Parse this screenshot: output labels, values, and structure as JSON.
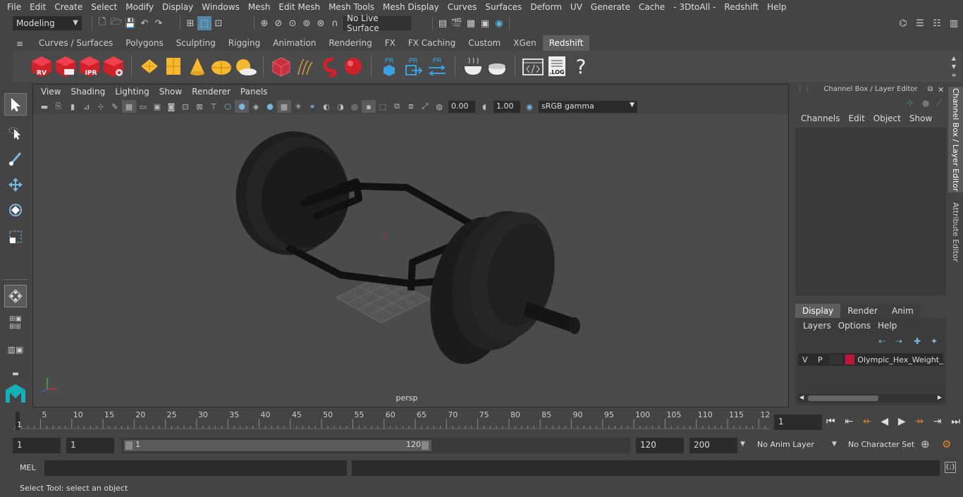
{
  "menubar": [
    "File",
    "Edit",
    "Create",
    "Select",
    "Modify",
    "Display",
    "Windows",
    "Mesh",
    "Edit Mesh",
    "Mesh Tools",
    "Mesh Display",
    "Curves",
    "Surfaces",
    "Deform",
    "UV",
    "Generate",
    "Cache",
    "- 3DtoAll -",
    "Redshift",
    "Help"
  ],
  "workspace": "Modeling",
  "live_surface": "No Live Surface",
  "shelf_tabs": [
    "Curves / Surfaces",
    "Polygons",
    "Sculpting",
    "Rigging",
    "Animation",
    "Rendering",
    "FX",
    "FX Caching",
    "Custom",
    "XGen",
    "Redshift"
  ],
  "shelf_active": "Redshift",
  "shelf_labels": {
    "rv": "RV",
    "ipr": "IPR",
    "pr": "PR",
    "log": ".LOG",
    "help": "?"
  },
  "viewport": {
    "menus": [
      "View",
      "Shading",
      "Lighting",
      "Show",
      "Renderer",
      "Panels"
    ],
    "exposure": "0.00",
    "gamma": "1.00",
    "colorspace": "sRGB gamma",
    "camera_label": "persp"
  },
  "channel_box": {
    "title": "Channel Box / Layer Editor",
    "menus": [
      "Channels",
      "Edit",
      "Object",
      "Show"
    ],
    "layer_tabs": [
      "Display",
      "Render",
      "Anim"
    ],
    "layer_active": "Display",
    "layer_menus": [
      "Layers",
      "Options",
      "Help"
    ],
    "layer": {
      "v": "V",
      "p": "P",
      "name": "Olympic_Hex_Weight_I",
      "color": "#c0143c"
    }
  },
  "side_tabs": [
    "Channel Box / Layer Editor",
    "Attribute Editor"
  ],
  "timeline": {
    "ticks": [
      "5",
      "10",
      "15",
      "20",
      "25",
      "30",
      "35",
      "40",
      "45",
      "50",
      "55",
      "60",
      "65",
      "70",
      "75",
      "80",
      "85",
      "90",
      "95",
      "100",
      "105",
      "110",
      "115",
      "12"
    ],
    "start_marker": "1",
    "current_frame": "1"
  },
  "range": {
    "start": "1",
    "anim_start": "1",
    "slider_start": "1",
    "slider_end": "120",
    "end": "120",
    "anim_end": "200",
    "anim_layer": "No Anim Layer",
    "char_set": "No Character Set"
  },
  "cmd": {
    "lang": "MEL"
  },
  "help_text": "Select Tool: select an object",
  "colors": {
    "bg": "#444444",
    "field": "#2b2b2b",
    "accent": "#5285a6",
    "redshift_red": "#d0202a",
    "layer": "#c0143c"
  }
}
